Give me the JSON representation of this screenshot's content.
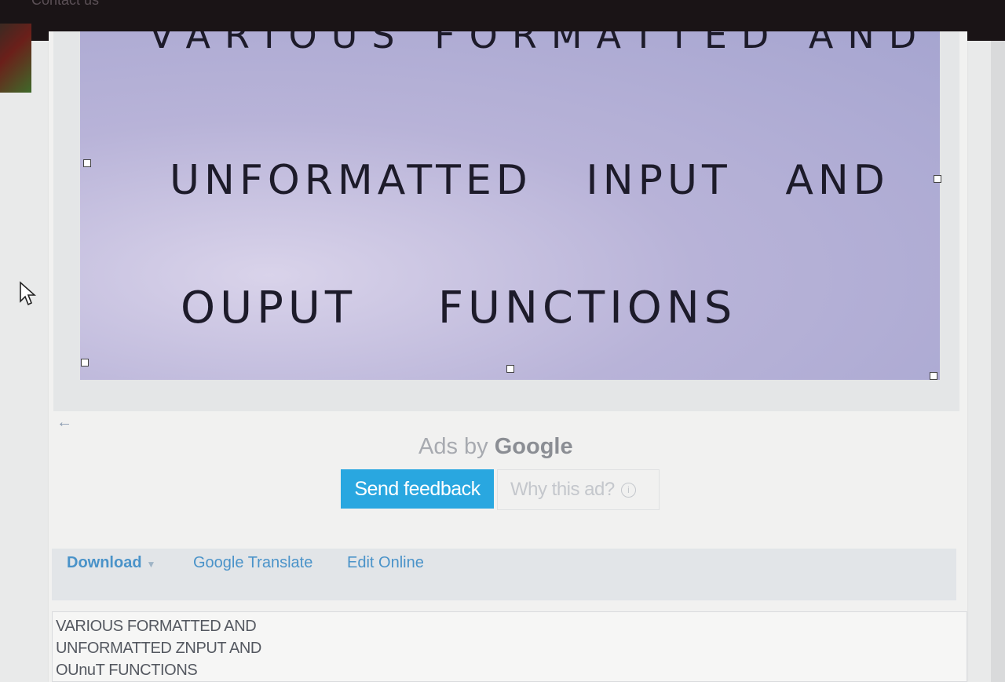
{
  "topbar": {
    "partial_text": "Contact us"
  },
  "image": {
    "handwritten_lines": [
      "VARIOUS FORMATTED AND",
      "UNFORMATTED INPUT AND",
      "OUPUT FUNCTIONS"
    ]
  },
  "nav": {
    "back_icon": "arrow-left-icon"
  },
  "ads": {
    "label_prefix": "Ads by",
    "label_brand": "Google",
    "feedback_button": "Send feedback",
    "why_ad": "Why this ad?",
    "info_icon": "info-icon"
  },
  "toolbar": {
    "download": "Download",
    "translate": "Google Translate",
    "edit": "Edit Online"
  },
  "ocr_text": {
    "lines": [
      "VARIOUS FORMATTED AND",
      "UNFORMATTED  ZNPUT AND",
      "OUnuT FUNCTIONS"
    ]
  }
}
